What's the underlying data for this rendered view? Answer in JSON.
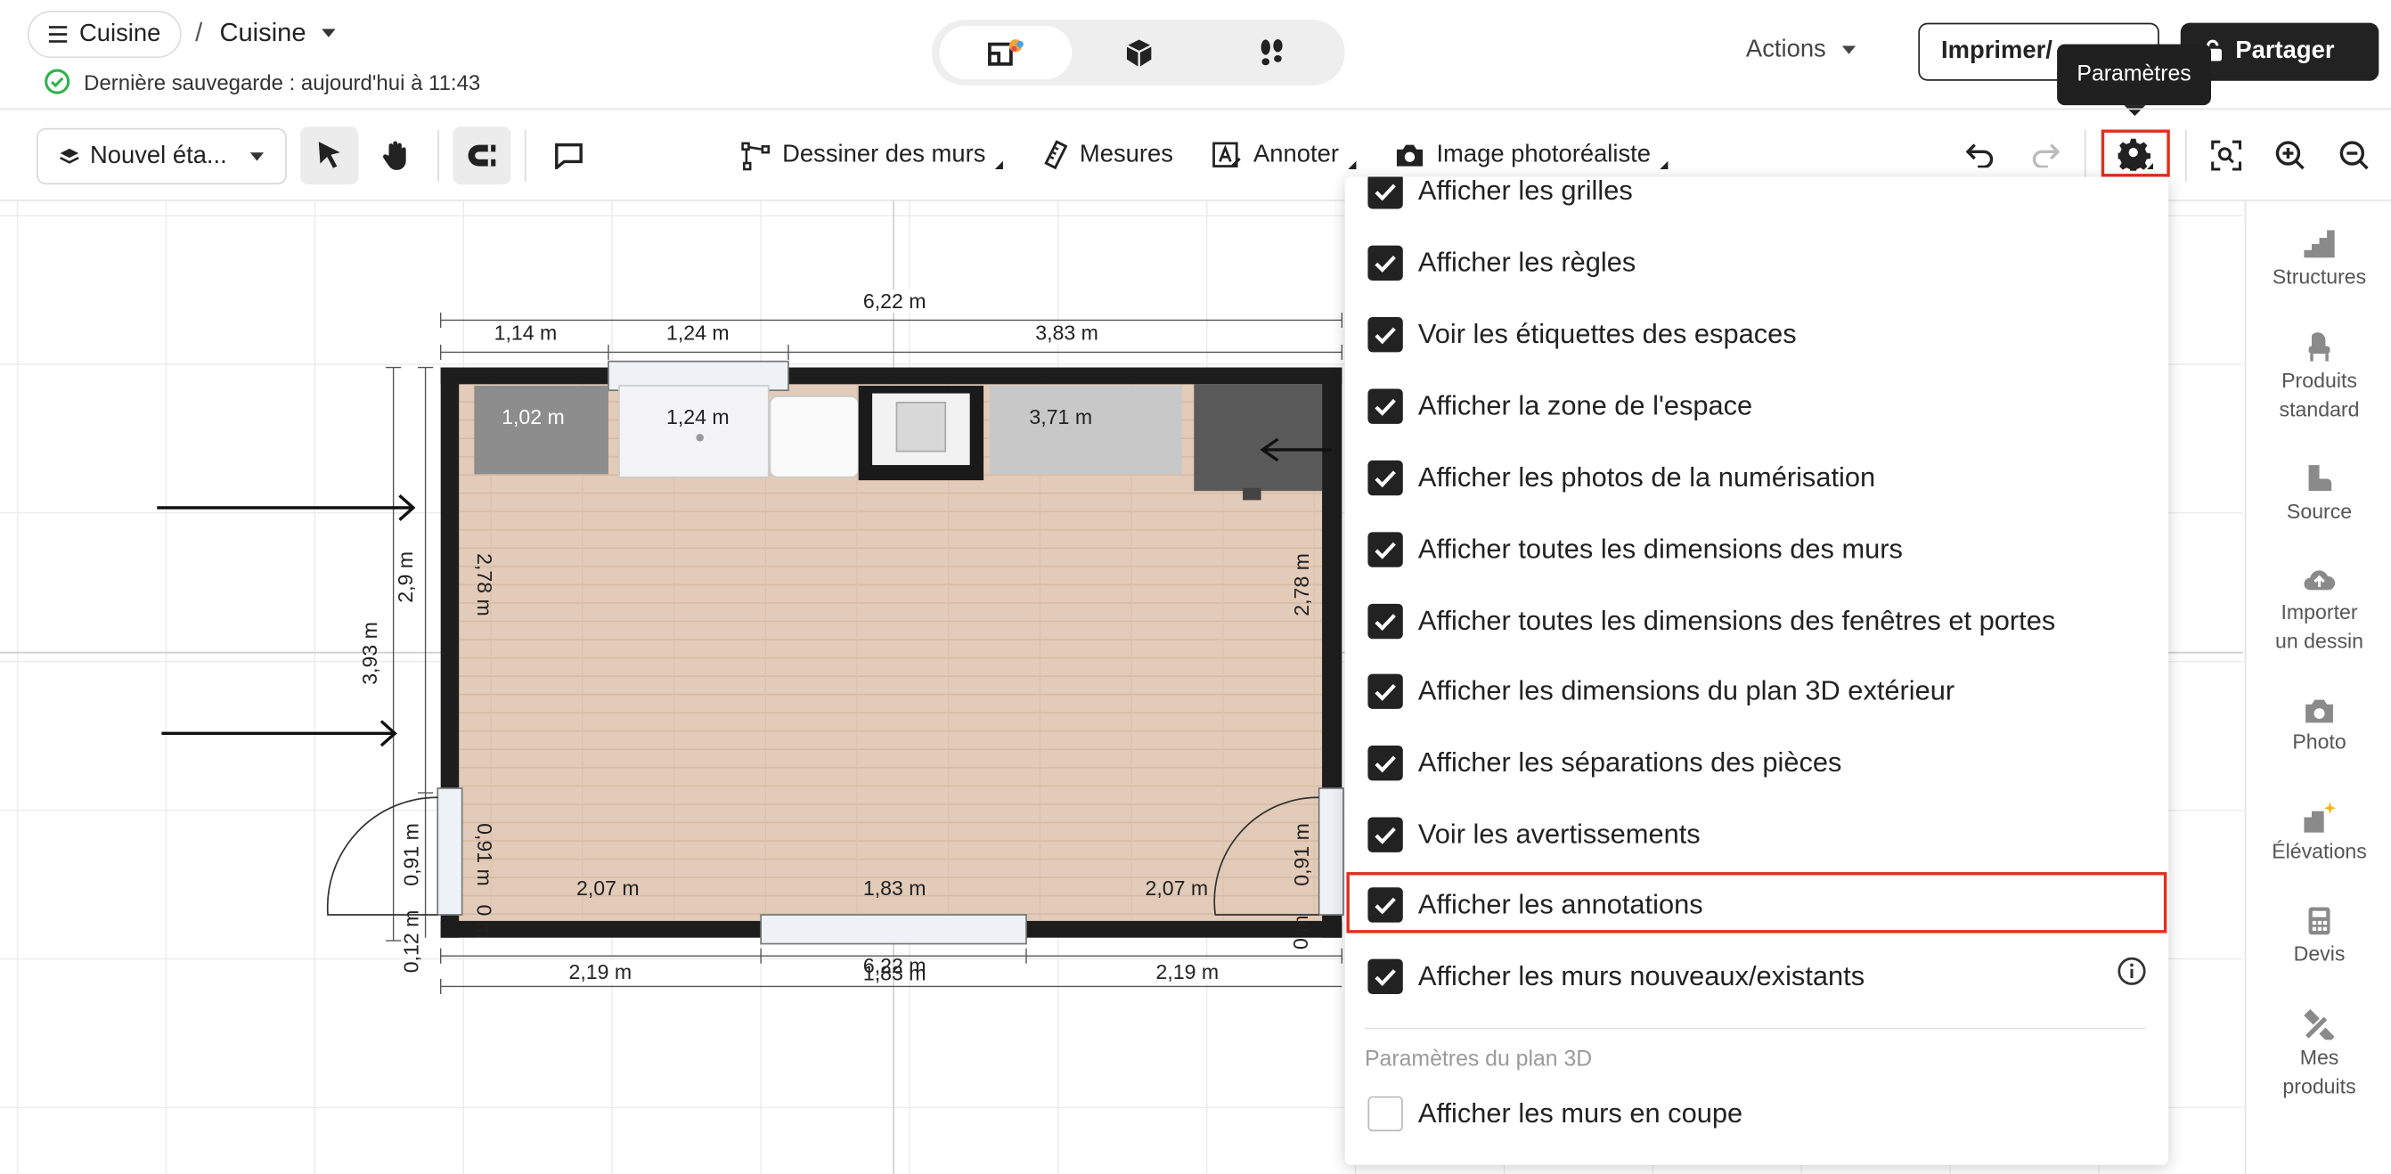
{
  "header": {
    "menu_label": "Cuisine",
    "separator": "/",
    "project_name": "Cuisine",
    "save_status": "Dernière sauvegarde : aujourd'hui à 11:43",
    "actions_label": "Actions",
    "print_label": "Imprimer/",
    "share_label": "Partager",
    "tooltip": "Paramètres"
  },
  "toolbar": {
    "floor_label": "Nouvel éta...",
    "draw_walls": "Dessiner des murs",
    "measures": "Mesures",
    "annotate": "Annoter",
    "photo": "Image photoréaliste"
  },
  "plan": {
    "dim_total_width": "6,22 m",
    "dim_top_1": "1,14 m",
    "dim_top_2": "1,24 m",
    "dim_top_3": "3,83 m",
    "dim_in_1": "1,02 m",
    "dim_in_2": "1,24 m",
    "dim_in_3": "3,71 m",
    "dim_left_total": "3,93 m",
    "dim_left_1": "2,9 m",
    "dim_left_inner": "2,78 m",
    "dim_right_inner": "2,78 m",
    "dim_left_door": "0,91 m",
    "dim_left_door_in": "0,91 m",
    "dim_left_small": "0,12 m",
    "dim_left_zero": "0 m",
    "dim_right_door": "0,91 m",
    "dim_right_zero": "0 m",
    "dim_bot_in_1": "2,07 m",
    "dim_bot_in_2": "1,83 m",
    "dim_bot_in_3": "2,07 m",
    "dim_bot_1": "2,19 m",
    "dim_bot_2": "1,83 m",
    "dim_bot_2b": "6,22 m",
    "dim_bot_3": "2,19 m"
  },
  "settings_menu": {
    "items": [
      {
        "label": "Afficher les grilles",
        "checked": true
      },
      {
        "label": "Afficher les règles",
        "checked": true
      },
      {
        "label": "Voir les étiquettes des espaces",
        "checked": true
      },
      {
        "label": "Afficher la zone de l'espace",
        "checked": true
      },
      {
        "label": "Afficher les photos de la numérisation",
        "checked": true
      },
      {
        "label": "Afficher toutes les dimensions des murs",
        "checked": true
      },
      {
        "label": "Afficher toutes les dimensions des fenêtres et portes",
        "checked": true
      },
      {
        "label": "Afficher les dimensions du plan 3D extérieur",
        "checked": true
      },
      {
        "label": "Afficher les séparations des pièces",
        "checked": true
      },
      {
        "label": "Voir les avertissements",
        "checked": true
      },
      {
        "label": "Afficher les annotations",
        "checked": true,
        "highlighted": true
      },
      {
        "label": "Afficher les murs nouveaux/existants",
        "checked": true
      }
    ],
    "section_3d": "Paramètres du plan 3D",
    "item_3d": {
      "label": "Afficher les murs en coupe",
      "checked": false
    }
  },
  "sidebar": {
    "structures": "Structures",
    "products_1": "Produits",
    "products_2": "standard",
    "source": "Source",
    "import_1": "Importer",
    "import_2": "un dessin",
    "photo": "Photo",
    "elevations": "Élévations",
    "quote": "Devis",
    "my_products_1": "Mes",
    "my_products_2": "produits"
  },
  "colors": {
    "accent_red": "#e0301e",
    "dark": "#222222",
    "floor_wood": "#e2cbb8",
    "save_green": "#2db34a"
  }
}
